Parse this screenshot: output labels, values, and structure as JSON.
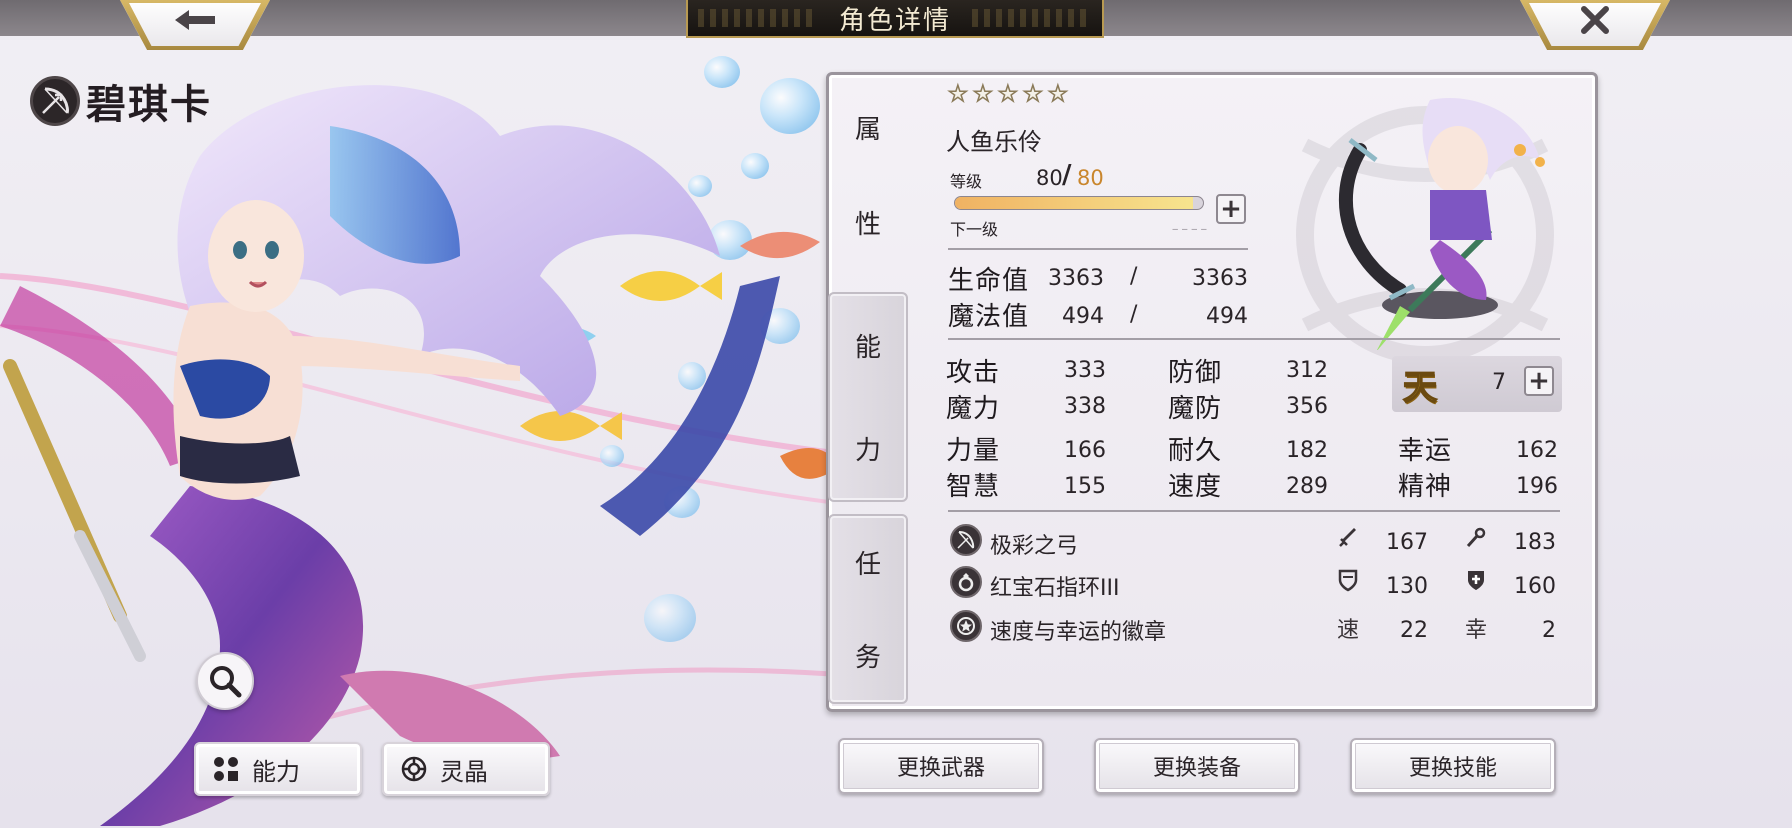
{
  "header": {
    "title": "角色详情"
  },
  "character": {
    "name": "碧琪卡",
    "stars": 5,
    "class_name": "人鱼乐伶"
  },
  "tabs": [
    "属性",
    "能力",
    "任务"
  ],
  "tab_chars": {
    "attr": [
      "属",
      "性"
    ],
    "ability": [
      "能",
      "力"
    ],
    "task": [
      "任",
      "务"
    ]
  },
  "level": {
    "label": "等级",
    "current": "80",
    "max": "80",
    "next_label": "下一级",
    "exp_fraction": 0.96
  },
  "hp": {
    "label": "生命值",
    "current": "3363",
    "max": "3363"
  },
  "mp": {
    "label": "魔法值",
    "current": "494",
    "max": "494"
  },
  "slash": "/",
  "stats": {
    "attack": {
      "label": "攻击",
      "value": "333"
    },
    "defense": {
      "label": "防御",
      "value": "312"
    },
    "magic": {
      "label": "魔力",
      "value": "338"
    },
    "magic_def": {
      "label": "魔防",
      "value": "356"
    },
    "strength": {
      "label": "力量",
      "value": "166"
    },
    "endurance": {
      "label": "耐久",
      "value": "182"
    },
    "luck": {
      "label": "幸运",
      "value": "162"
    },
    "wisdom": {
      "label": "智慧",
      "value": "155"
    },
    "speed": {
      "label": "速度",
      "value": "289"
    },
    "spirit": {
      "label": "精神",
      "value": "196"
    }
  },
  "rank": {
    "glyph": "天",
    "value": "7"
  },
  "equipment": [
    {
      "name": "极彩之弓",
      "icon": "bow-icon",
      "stat1_icon": "sword-icon",
      "stat1": "167",
      "stat2_icon": "staff-icon",
      "stat2": "183"
    },
    {
      "name": "红宝石指环III",
      "icon": "ring-icon",
      "stat1_icon": "shield-icon",
      "stat1": "130",
      "stat2_icon": "cross-shield-icon",
      "stat2": "160"
    },
    {
      "name": "速度与幸运的徽章",
      "icon": "badge-icon",
      "stat1_icon": "速",
      "stat1": "22",
      "stat2_icon": "幸",
      "stat2": "2"
    }
  ],
  "buttons": {
    "change_weapon": "更换武器",
    "change_equipment": "更换装备",
    "change_skill": "更换技能",
    "ability": "能力",
    "crystal": "灵晶"
  },
  "colors": {
    "accent_gold": "#c9a85a",
    "exp_max": "#c9862c",
    "rank_gold": "#f6cf2d"
  }
}
